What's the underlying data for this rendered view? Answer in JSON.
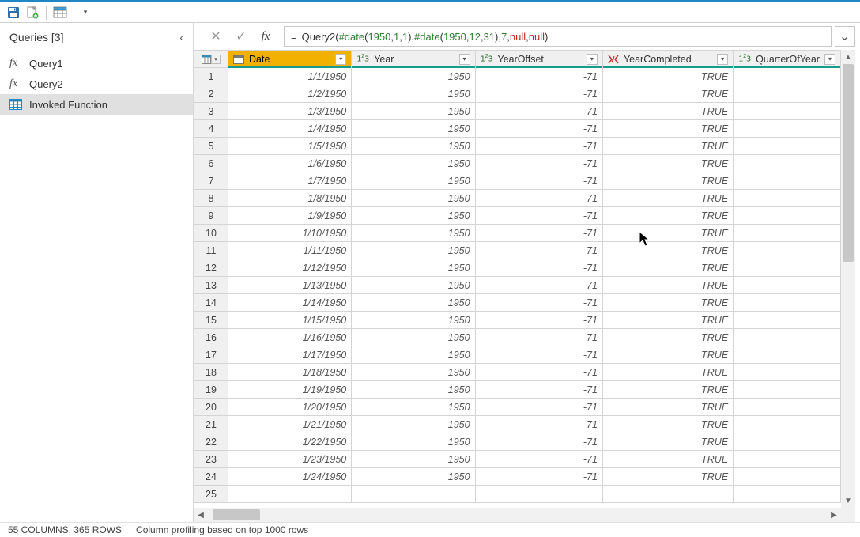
{
  "qat": {
    "save": "save-icon",
    "new": "new-icon",
    "grid": "grid-icon",
    "more": "▾"
  },
  "queries_pane": {
    "title": "Queries [3]",
    "collapse_glyph": "‹",
    "items": [
      {
        "icon": "fx",
        "label": "Query1",
        "selected": false
      },
      {
        "icon": "fx",
        "label": "Query2",
        "selected": false
      },
      {
        "icon": "table",
        "label": "Invoked Function",
        "selected": true
      }
    ]
  },
  "formula_bar": {
    "cancel_glyph": "✕",
    "accept_glyph": "✓",
    "fx_label": "fx",
    "formula_prefix": "=",
    "formula_tokens": [
      {
        "t": "fn",
        "v": " Query2("
      },
      {
        "t": "kw",
        "v": "#date"
      },
      {
        "t": "fn",
        "v": "("
      },
      {
        "t": "num",
        "v": "1950"
      },
      {
        "t": "fn",
        "v": ", "
      },
      {
        "t": "num",
        "v": "1"
      },
      {
        "t": "fn",
        "v": ", "
      },
      {
        "t": "num",
        "v": "1"
      },
      {
        "t": "fn",
        "v": "), "
      },
      {
        "t": "kw",
        "v": "#date"
      },
      {
        "t": "fn",
        "v": "("
      },
      {
        "t": "num",
        "v": "1950"
      },
      {
        "t": "fn",
        "v": ", "
      },
      {
        "t": "num",
        "v": "12"
      },
      {
        "t": "fn",
        "v": ", "
      },
      {
        "t": "num",
        "v": "31"
      },
      {
        "t": "fn",
        "v": "), "
      },
      {
        "t": "num",
        "v": "7"
      },
      {
        "t": "fn",
        "v": ", "
      },
      {
        "t": "null",
        "v": "null"
      },
      {
        "t": "fn",
        "v": ", "
      },
      {
        "t": "null",
        "v": "null"
      },
      {
        "t": "fn",
        "v": ")"
      }
    ],
    "expand_glyph": "⌄"
  },
  "grid": {
    "columns": [
      {
        "name": "Date",
        "type": "date",
        "selected": true
      },
      {
        "name": "Year",
        "type": "123",
        "selected": false
      },
      {
        "name": "YearOffset",
        "type": "123",
        "selected": false
      },
      {
        "name": "YearCompleted",
        "type": "bool",
        "selected": false
      },
      {
        "name": "QuarterOfYear",
        "type": "123",
        "selected": false
      }
    ],
    "rows": [
      {
        "n": 1,
        "date": "1/1/1950",
        "year": "1950",
        "off": "-71",
        "comp": "TRUE"
      },
      {
        "n": 2,
        "date": "1/2/1950",
        "year": "1950",
        "off": "-71",
        "comp": "TRUE"
      },
      {
        "n": 3,
        "date": "1/3/1950",
        "year": "1950",
        "off": "-71",
        "comp": "TRUE"
      },
      {
        "n": 4,
        "date": "1/4/1950",
        "year": "1950",
        "off": "-71",
        "comp": "TRUE"
      },
      {
        "n": 5,
        "date": "1/5/1950",
        "year": "1950",
        "off": "-71",
        "comp": "TRUE"
      },
      {
        "n": 6,
        "date": "1/6/1950",
        "year": "1950",
        "off": "-71",
        "comp": "TRUE"
      },
      {
        "n": 7,
        "date": "1/7/1950",
        "year": "1950",
        "off": "-71",
        "comp": "TRUE"
      },
      {
        "n": 8,
        "date": "1/8/1950",
        "year": "1950",
        "off": "-71",
        "comp": "TRUE"
      },
      {
        "n": 9,
        "date": "1/9/1950",
        "year": "1950",
        "off": "-71",
        "comp": "TRUE"
      },
      {
        "n": 10,
        "date": "1/10/1950",
        "year": "1950",
        "off": "-71",
        "comp": "TRUE"
      },
      {
        "n": 11,
        "date": "1/11/1950",
        "year": "1950",
        "off": "-71",
        "comp": "TRUE"
      },
      {
        "n": 12,
        "date": "1/12/1950",
        "year": "1950",
        "off": "-71",
        "comp": "TRUE"
      },
      {
        "n": 13,
        "date": "1/13/1950",
        "year": "1950",
        "off": "-71",
        "comp": "TRUE"
      },
      {
        "n": 14,
        "date": "1/14/1950",
        "year": "1950",
        "off": "-71",
        "comp": "TRUE"
      },
      {
        "n": 15,
        "date": "1/15/1950",
        "year": "1950",
        "off": "-71",
        "comp": "TRUE"
      },
      {
        "n": 16,
        "date": "1/16/1950",
        "year": "1950",
        "off": "-71",
        "comp": "TRUE"
      },
      {
        "n": 17,
        "date": "1/17/1950",
        "year": "1950",
        "off": "-71",
        "comp": "TRUE"
      },
      {
        "n": 18,
        "date": "1/18/1950",
        "year": "1950",
        "off": "-71",
        "comp": "TRUE"
      },
      {
        "n": 19,
        "date": "1/19/1950",
        "year": "1950",
        "off": "-71",
        "comp": "TRUE"
      },
      {
        "n": 20,
        "date": "1/20/1950",
        "year": "1950",
        "off": "-71",
        "comp": "TRUE"
      },
      {
        "n": 21,
        "date": "1/21/1950",
        "year": "1950",
        "off": "-71",
        "comp": "TRUE"
      },
      {
        "n": 22,
        "date": "1/22/1950",
        "year": "1950",
        "off": "-71",
        "comp": "TRUE"
      },
      {
        "n": 23,
        "date": "1/23/1950",
        "year": "1950",
        "off": "-71",
        "comp": "TRUE"
      },
      {
        "n": 24,
        "date": "1/24/1950",
        "year": "1950",
        "off": "-71",
        "comp": "TRUE"
      },
      {
        "n": 25,
        "date": "",
        "year": "",
        "off": "",
        "comp": ""
      }
    ]
  },
  "status_bar": {
    "summary": "55 COLUMNS, 365 ROWS",
    "profiling": "Column profiling based on top 1000 rows"
  },
  "glyphs": {
    "drop": "▾",
    "up": "▲",
    "down": "▼",
    "left": "◀",
    "right": "▶"
  }
}
